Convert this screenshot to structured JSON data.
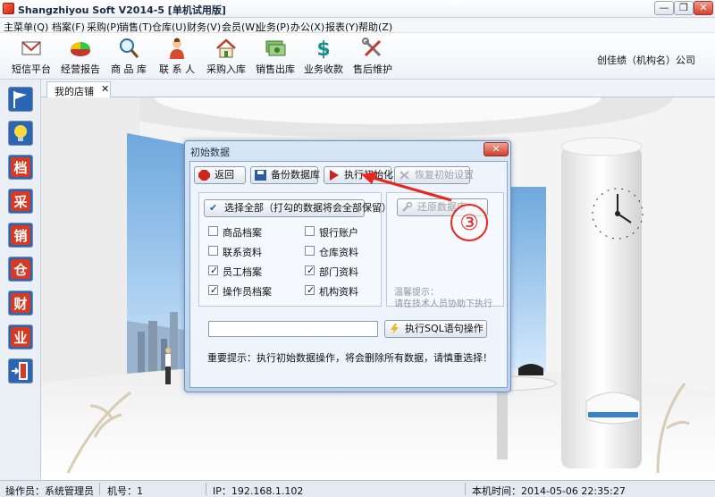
{
  "window": {
    "title": "Shangzhiyou Soft V2014-5 [单机试用版]",
    "min_label": "—",
    "max_label": "❐",
    "close_label": "✕"
  },
  "menu": [
    "主菜单(Q)",
    "档案(F)",
    "采购(P)",
    "销售(T)",
    "仓库(U)",
    "财务(V)",
    "会员(W)",
    "业务(P)",
    "办公(X)",
    "报表(Y)",
    "帮助(Z)"
  ],
  "toolbar": {
    "items": [
      {
        "label": "短信平台",
        "icon": "envelope-icon"
      },
      {
        "label": "经营报告",
        "icon": "pie-chart-icon"
      },
      {
        "label": "商 品 库",
        "icon": "magnifier-icon"
      },
      {
        "label": "联 系 人",
        "icon": "person-icon"
      },
      {
        "label": "采购入库",
        "icon": "house-icon"
      },
      {
        "label": "销售出库",
        "icon": "money-icon"
      },
      {
        "label": "业务收款",
        "icon": "dollar-icon"
      },
      {
        "label": "售后维护",
        "icon": "tools-icon"
      }
    ],
    "company": "创佳绩（机构名）公司"
  },
  "sidebar": {
    "items": [
      {
        "icon": "flag-icon",
        "glyph": ""
      },
      {
        "icon": "lightbulb-icon",
        "glyph": ""
      },
      {
        "icon": "archive-icon",
        "glyph": "档"
      },
      {
        "icon": "purchase-icon",
        "glyph": "采"
      },
      {
        "icon": "sales-icon",
        "glyph": "销"
      },
      {
        "icon": "warehouse-icon",
        "glyph": "仓"
      },
      {
        "icon": "finance-icon",
        "glyph": "财"
      },
      {
        "icon": "business-icon",
        "glyph": "业"
      },
      {
        "icon": "exit-icon",
        "glyph": ""
      }
    ]
  },
  "tabs": [
    {
      "label": "我的店铺",
      "close": "✕"
    }
  ],
  "dialog": {
    "title": "初始数据",
    "close_label": "✕",
    "buttons": {
      "back": "返回",
      "backup": "备份数据库",
      "execute": "执行初始化",
      "restore": "恢复初始设置",
      "restore_db": "还原数据库",
      "sql": "执行SQL语句操作"
    },
    "select_all": "选择全部（打勾的数据将会全部保留）",
    "checkboxes": [
      {
        "label": "商品档案",
        "checked": false
      },
      {
        "label": "银行账户",
        "checked": false
      },
      {
        "label": "联系资料",
        "checked": false
      },
      {
        "label": "仓库资料",
        "checked": false
      },
      {
        "label": "员工档案",
        "checked": true
      },
      {
        "label": "部门资料",
        "checked": true
      },
      {
        "label": "操作员档案",
        "checked": true
      },
      {
        "label": "机构资料",
        "checked": true
      }
    ],
    "hint_title": "温馨提示：",
    "hint_body": "请在技术人员协助下执行",
    "sql_value": "",
    "notice": "重要提示：执行初始数据操作，将会删除所有数据，请慎重选择！"
  },
  "annotation": {
    "marker": "③",
    "color": "#e8261f"
  },
  "status": {
    "operator": "操作员：系统管理员",
    "machine": "机号：1",
    "ip": "IP：192.168.1.102",
    "time": "本机时间：2014-05-06 22:35:27"
  },
  "colors": {
    "accent": "#3c6fb0",
    "annotation_red": "#e8261f"
  }
}
